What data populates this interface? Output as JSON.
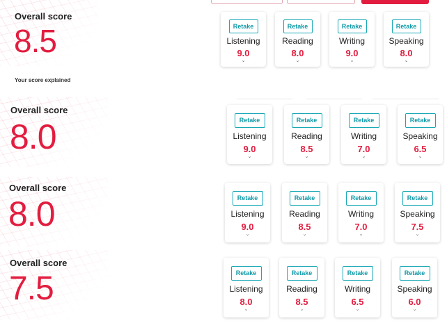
{
  "explain_text": "Your score explained",
  "sections": [
    {
      "label": "Overall score",
      "score": "8.5",
      "skills": [
        {
          "retake": "Retake",
          "name": "Listening",
          "band": "9.0"
        },
        {
          "retake": "Retake",
          "name": "Reading",
          "band": "8.0"
        },
        {
          "retake": "Retake",
          "name": "Writing",
          "band": "9.0"
        },
        {
          "retake": "Retake",
          "name": "Speaking",
          "band": "8.0"
        }
      ]
    },
    {
      "label": "Overall score",
      "score": "8.0",
      "skills": [
        {
          "retake": "Retake",
          "name": "Listening",
          "band": "9.0"
        },
        {
          "retake": "Retake",
          "name": "Reading",
          "band": "8.5"
        },
        {
          "retake": "Retake",
          "name": "Writing",
          "band": "7.0"
        },
        {
          "retake": "Retake",
          "name": "Speaking",
          "band": "6.5"
        }
      ]
    },
    {
      "label": "Overall score",
      "score": "8.0",
      "skills": [
        {
          "retake": "Retake",
          "name": "Listening",
          "band": "9.0"
        },
        {
          "retake": "Retake",
          "name": "Reading",
          "band": "8.5"
        },
        {
          "retake": "Retake",
          "name": "Writing",
          "band": "7.0"
        },
        {
          "retake": "Retake",
          "name": "Speaking",
          "band": "7.5"
        }
      ]
    },
    {
      "label": "Overall score",
      "score": "7.5",
      "skills": [
        {
          "retake": "Retake",
          "name": "Listening",
          "band": "8.0"
        },
        {
          "retake": "Retake",
          "name": "Reading",
          "band": "8.5"
        },
        {
          "retake": "Retake",
          "name": "Writing",
          "band": "6.5"
        },
        {
          "retake": "Retake",
          "name": "Speaking",
          "band": "6.0"
        }
      ]
    }
  ],
  "colors": {
    "accent_red": "#e21d3f",
    "teal": "#17a7b6"
  },
  "icons": {
    "chevron": "chevron-down-icon"
  }
}
